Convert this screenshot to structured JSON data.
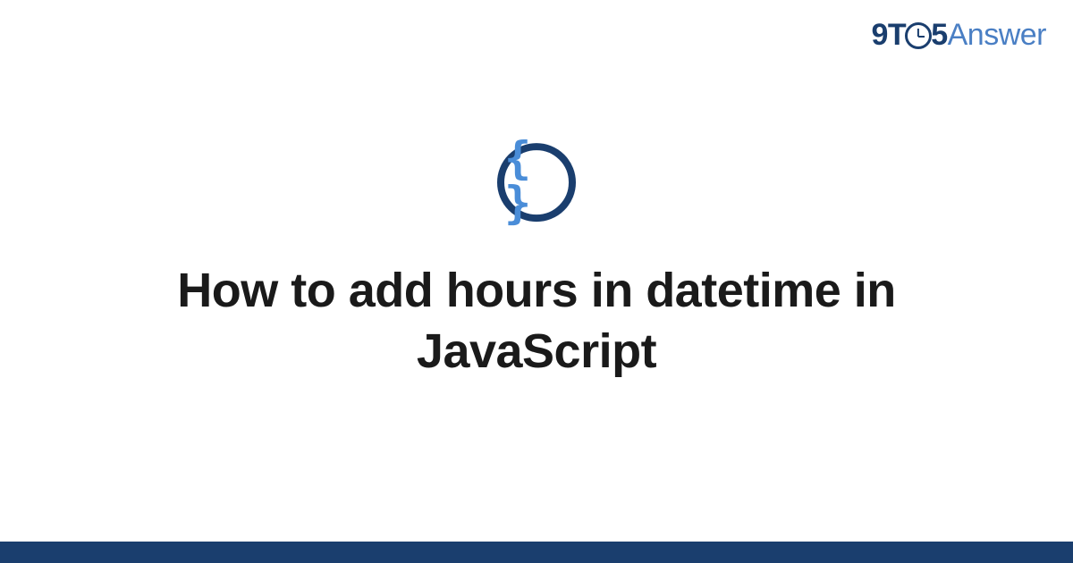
{
  "logo": {
    "prefix": "9T",
    "middle": "5",
    "suffix": "Answer"
  },
  "icon": {
    "glyph": "{ }"
  },
  "title": "How to add hours in datetime in JavaScript",
  "colors": {
    "brand_dark": "#1a3e6e",
    "brand_light": "#4a7fc4",
    "code_blue": "#4a8dd8"
  }
}
